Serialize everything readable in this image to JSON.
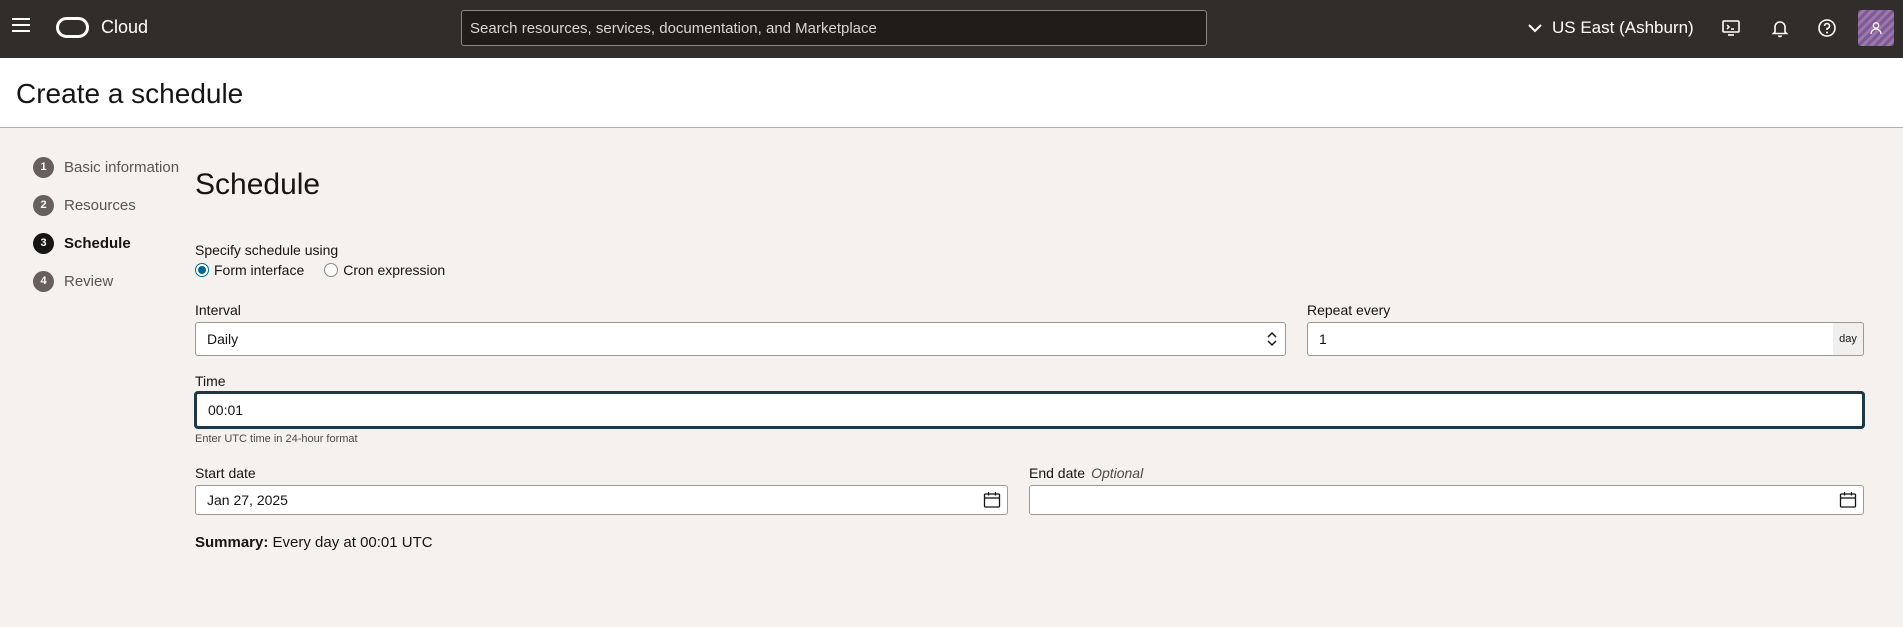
{
  "topbar": {
    "brand": "Cloud",
    "search_placeholder": "Search resources, services, documentation, and Marketplace",
    "region": "US East (Ashburn)"
  },
  "page_title": "Create a schedule",
  "steps": [
    {
      "num": "1",
      "label": "Basic information"
    },
    {
      "num": "2",
      "label": "Resources"
    },
    {
      "num": "3",
      "label": "Schedule"
    },
    {
      "num": "4",
      "label": "Review"
    }
  ],
  "form": {
    "section_title": "Schedule",
    "specify_label": "Specify schedule using",
    "radio_form": "Form interface",
    "radio_cron": "Cron expression",
    "interval_label": "Interval",
    "interval_value": "Daily",
    "repeat_label": "Repeat every",
    "repeat_value": "1",
    "repeat_unit": "day",
    "time_label": "Time",
    "time_value": "00:01",
    "time_hint": "Enter UTC time in 24-hour format",
    "start_label": "Start date",
    "start_value": "Jan 27, 2025",
    "end_label": "End date",
    "end_optional": "Optional",
    "end_value": "",
    "summary_label": "Summary:",
    "summary_text": "Every day at 00:01 UTC"
  }
}
